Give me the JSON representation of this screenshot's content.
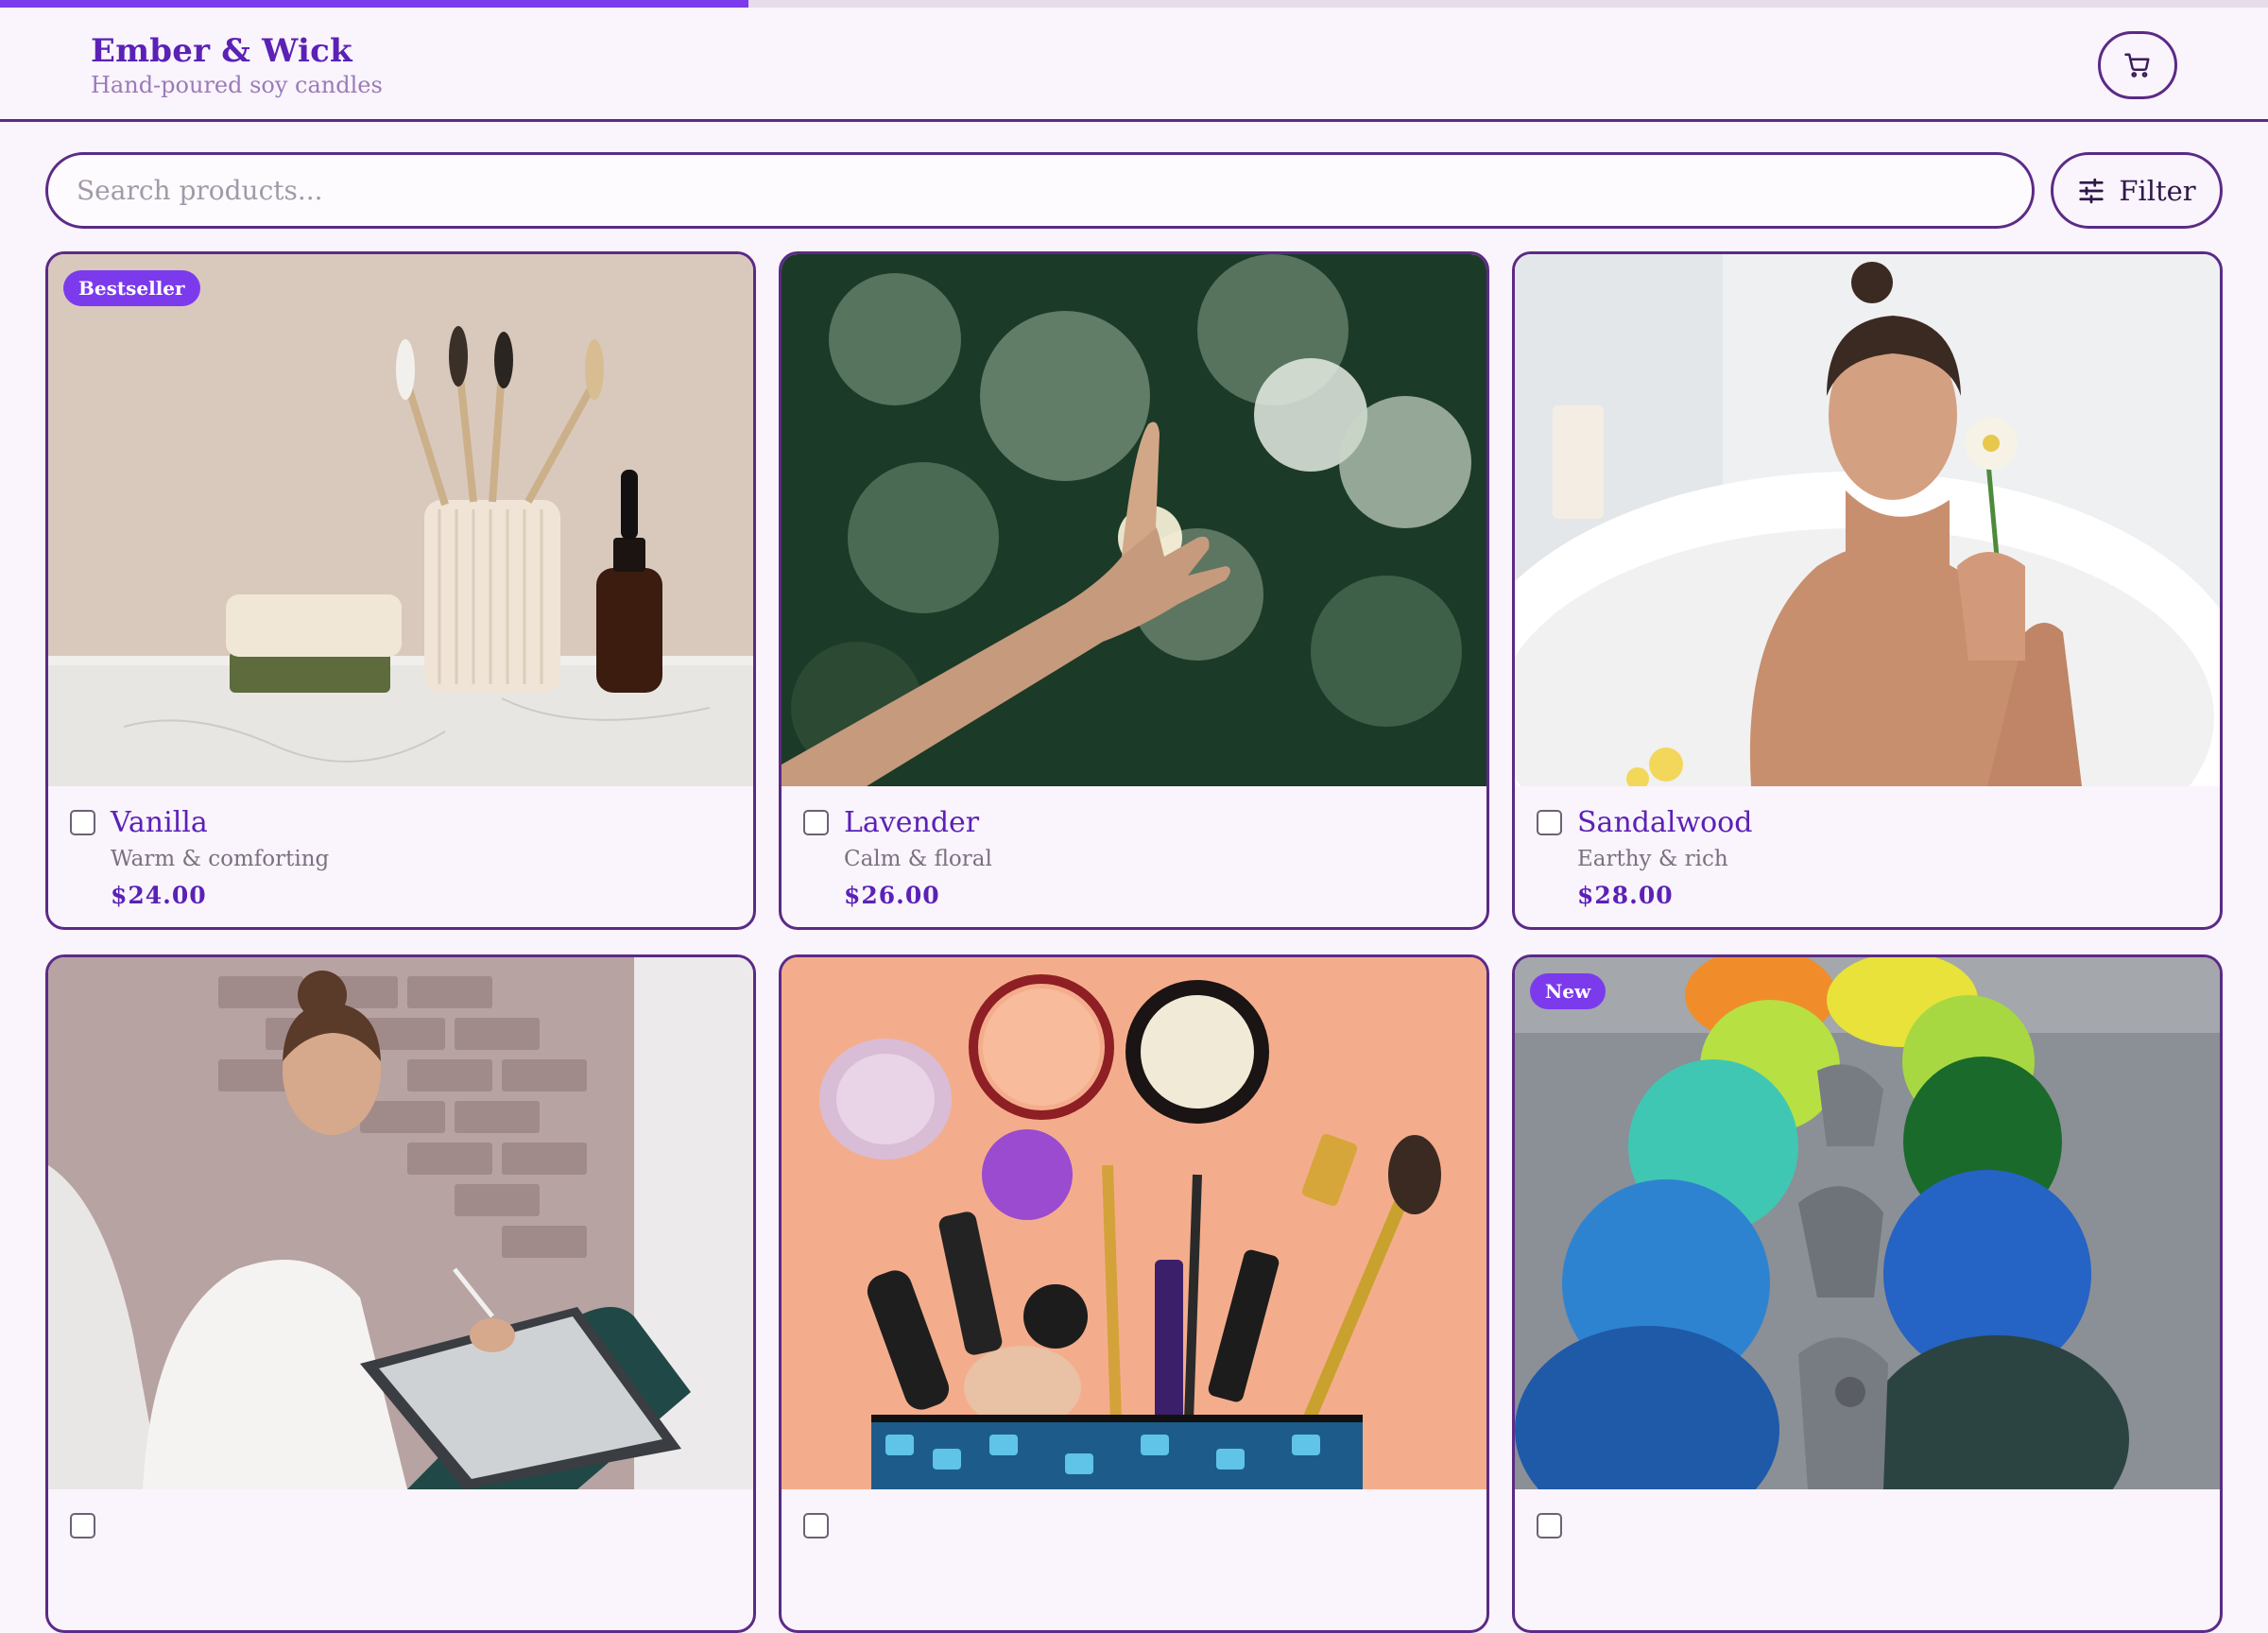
{
  "progress": {
    "percent": 33
  },
  "header": {
    "brand": "Ember & Wick",
    "tagline": "Hand-poured soy candles",
    "cart_icon": "cart-icon"
  },
  "search": {
    "placeholder": "Search products...",
    "value": ""
  },
  "filter": {
    "label": "Filter",
    "icon": "sliders-icon"
  },
  "colors": {
    "accent": "#7c3aed",
    "brand": "#5b21b6",
    "border": "#5b2a86",
    "background": "#faf4fc"
  },
  "products": [
    {
      "name": "Vanilla",
      "desc": "Warm & comforting",
      "price": "$24.00",
      "badge": "Bestseller",
      "checked": false,
      "image": "bathroom shelf with soap, toothbrushes, dropper bottle"
    },
    {
      "name": "Lavender",
      "desc": "Calm & floral",
      "price": "$26.00",
      "badge": "",
      "checked": false,
      "image": "hand reaching toward sunlight through leaves"
    },
    {
      "name": "Sandalwood",
      "desc": "Earthy & rich",
      "price": "$28.00",
      "badge": "",
      "checked": false,
      "image": "woman in bath smelling a white flower"
    },
    {
      "name": "",
      "desc": "",
      "price": "",
      "badge": "",
      "checked": false,
      "image": "woman drawing on a tablet by a brick wall"
    },
    {
      "name": "",
      "desc": "",
      "price": "",
      "badge": "",
      "checked": false,
      "image": "makeup products spilling from a pouch on peach background"
    },
    {
      "name": "",
      "desc": "",
      "price": "",
      "badge": "New",
      "checked": false,
      "image": "colorful dyed eggs in a carton"
    }
  ]
}
